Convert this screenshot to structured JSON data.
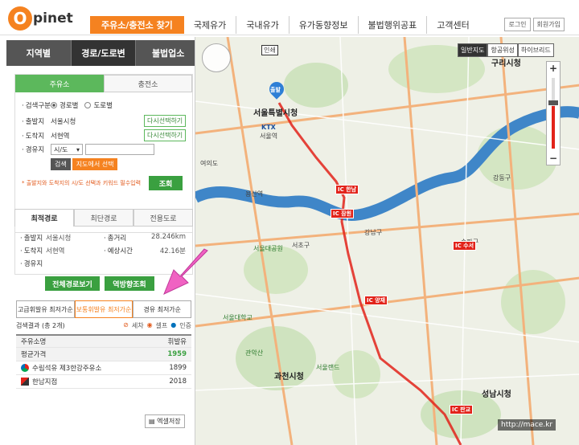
{
  "header": {
    "logo_o": "O",
    "logo_text": "pinet",
    "nav": [
      "주유소/충전소 찾기",
      "국제유가",
      "국내유가",
      "유가동향정보",
      "불법행위공표",
      "고객센터"
    ],
    "login": "로그인",
    "signup": "회원가입"
  },
  "left": {
    "region_tabs": [
      "지역별",
      "경로/도로변",
      "불법업소"
    ],
    "search_tabs": [
      "주유소",
      "충전소"
    ],
    "search_type_label": "검색구분",
    "search_type_options": [
      "경로별",
      "도로별"
    ],
    "start_label": "출발지",
    "start_value": "서울시청",
    "start_btn": "다시선택하기",
    "dest_label": "도착지",
    "dest_value": "서현역",
    "dest_btn": "다시선택하기",
    "via_label": "경유지",
    "via_select": "시/도",
    "search_btn": "검색",
    "map_select_btn": "지도에서 선택",
    "warning": "* 출발지와 도착지의 시/도 선택과 키워드 필수입력",
    "query_btn": "조회",
    "route_tabs": [
      "최적경로",
      "최단경로",
      "전용도로"
    ],
    "route_info": {
      "start_label": "출발지",
      "start_value": "서울시청",
      "total_label": "총거리",
      "total_value": "28.246km",
      "dest_label": "도착지",
      "dest_value": "서현역",
      "time_label": "예상시간",
      "time_value": "42.16분",
      "via_label": "경유지"
    },
    "full_route_btn": "전체경로보기",
    "reverse_btn": "역방향조회",
    "fuel_tabs": [
      "고급휘발유 최저가순",
      "보통휘발유 최저가순",
      "경유 최저가순"
    ],
    "results_label": "검색결과 (총 2개)",
    "legend": [
      "세차",
      "셀프",
      "인증"
    ],
    "table_headers": [
      "주유소명",
      "휘발유"
    ],
    "avg_label": "평균가격",
    "avg_value": "1959",
    "rows": [
      {
        "name": "수림석유 제3한강주유소",
        "price": "1899"
      },
      {
        "name": "한남지점",
        "price": "2018"
      }
    ],
    "excel_btn": "엑셀저장"
  },
  "map": {
    "map_types": [
      "일반지도",
      "항공위성",
      "하이브리드"
    ],
    "labels": {
      "city_hall": "서울특별시청",
      "seoul_station": "서울역",
      "guri": "구리시청",
      "gwacheon": "과천시청",
      "seongnam": "성남시청",
      "yongsan": "용산역",
      "gangnam": "강남구",
      "gangdong": "강동구",
      "seocho": "서초구",
      "songpa": "송파구",
      "seoul_park": "서울대공원",
      "seoul_univ": "서울대학교",
      "seoul_land": "서울랜드",
      "gwanak": "관악산",
      "yeouido": "여의도",
      "start_pin": "출발",
      "ktx": "KTX",
      "injum": "인쇄"
    },
    "ic_labels": [
      "IC 한남",
      "IC 잠원",
      "IC 양재",
      "IC 수서",
      "IC 판교"
    ],
    "watermark": "http://mace.kr"
  }
}
